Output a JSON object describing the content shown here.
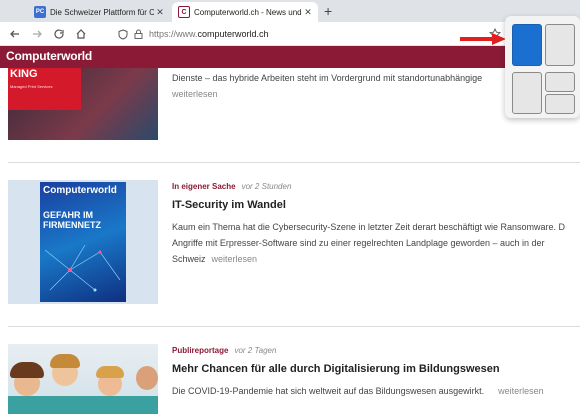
{
  "tabs": [
    {
      "icon": "PC",
      "title": "Die Schweizer Plattform für Co",
      "close": "✕"
    },
    {
      "icon": "C",
      "title": "Computerworld.ch - News und",
      "close": "✕"
    }
  ],
  "new_tab": "+",
  "address": {
    "prefix": "https://www.",
    "host": "computerworld.ch"
  },
  "site": {
    "logo": "Computerworld"
  },
  "articles": [
    {
      "teaser_tail": "Dienste – das hybride Arbeiten steht im Vordergrund mit standortunabhängige",
      "more": "weiterlesen",
      "thumb_text": "KING",
      "thumb_sub": "Managed Print Services"
    },
    {
      "category": "In eigener Sache",
      "time": "vor 2 Stunden",
      "headline": "IT-Security im Wandel",
      "teaser_1": "Kaum ein Thema hat die Cybersecurity-Szene in letzter Zeit derart beschäftigt wie Ransomware. D",
      "teaser_2": "Angriffe mit Erpresser-Software sind zu einer regelrechten Landplage geworden – auch in der",
      "teaser_3": "Schweiz",
      "more": "weiterlesen",
      "cover_brand": "Computerworld",
      "cover_title_1": "GEFAHR IM",
      "cover_title_2": "FIRMENNETZ"
    },
    {
      "category": "Publireportage",
      "time": "vor 2 Tagen",
      "headline": "Mehr Chancen für alle durch Digitalisierung im Bildungswesen",
      "teaser_1": "Die COVID-19-Pandemie hat sich weltweit auf das Bildungswesen ausgewirkt.",
      "more": "weiterlesen"
    }
  ],
  "colors": {
    "brand": "#8b1a37",
    "snap_selected": "#1a6fd0",
    "arrow": "#e02020"
  }
}
